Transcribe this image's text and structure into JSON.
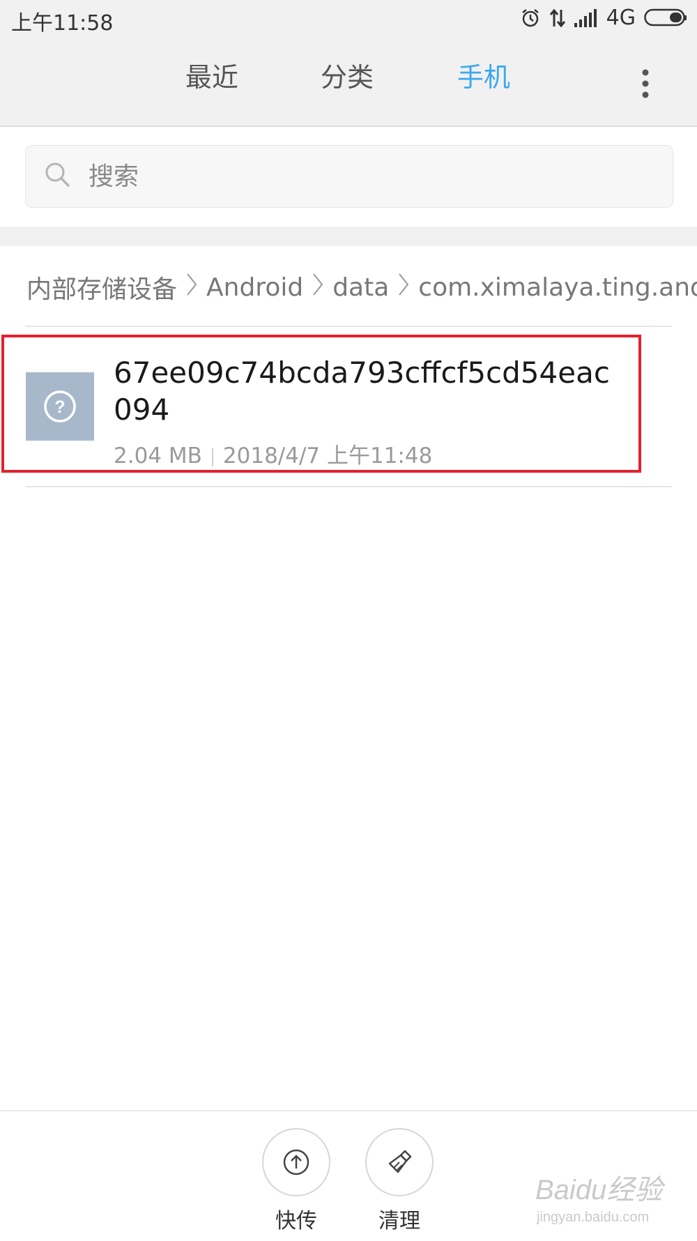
{
  "status_bar": {
    "time": "上午11:58",
    "network": "4G",
    "icons": [
      "alarm-icon",
      "data-transfer-icon",
      "signal-icon",
      "battery-icon"
    ]
  },
  "tabs": [
    {
      "label": "最近",
      "active": false
    },
    {
      "label": "分类",
      "active": false
    },
    {
      "label": "手机",
      "active": true
    }
  ],
  "colors": {
    "accent": "#3ba8f0",
    "highlight_border": "#e3202b",
    "thumb": "#a7b8cb"
  },
  "search": {
    "placeholder": "搜索"
  },
  "breadcrumb": [
    "内部存储设备",
    "Android",
    "data",
    "com.ximalaya.ting.andr"
  ],
  "file": {
    "name": "67ee09c74bcda793cffcf5cd54eac094",
    "size": "2.04 MB",
    "modified": "2018/4/7 上午11:48",
    "icon": "unknown-file-icon"
  },
  "bottom_actions": [
    {
      "label": "快传",
      "icon": "upload-icon"
    },
    {
      "label": "清理",
      "icon": "broom-icon"
    }
  ],
  "watermark": {
    "brand": "Baidu经验",
    "url": "jingyan.baidu.com"
  }
}
